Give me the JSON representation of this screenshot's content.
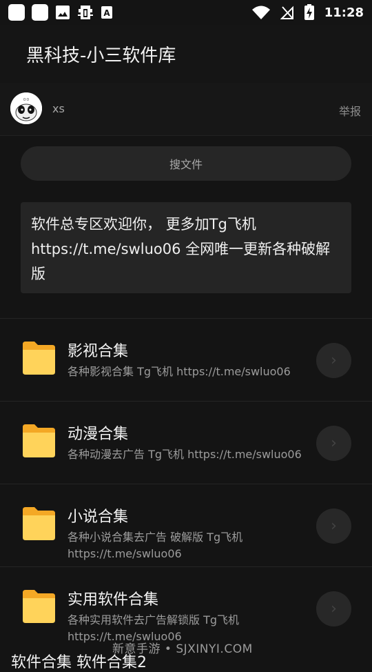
{
  "status": {
    "time": "11:28",
    "icons": [
      "app-icon-1",
      "app-icon-2",
      "image-icon",
      "bug-icon",
      "font-icon",
      "wifi-icon",
      "no-signal-icon",
      "battery-charging-icon"
    ]
  },
  "app": {
    "title": "黑科技-小三软件库"
  },
  "user": {
    "name": "xs",
    "report_label": "举报"
  },
  "search": {
    "label": "搜文件"
  },
  "notice": {
    "text": "软件总专区欢迎你， 更多加Tg飞机 https://t.me/swluo06 全网唯一更新各种破解版"
  },
  "items": [
    {
      "title": "影视合集",
      "desc": "各种影视合集 Tg飞机 https://t.me/swluo06"
    },
    {
      "title": "动漫合集",
      "desc": "各种动漫去广告 Tg飞机 https://t.me/swluo06"
    },
    {
      "title": "小说合集",
      "desc": "各种小说合集去广告 破解版 Tg飞机 https://t.me/swluo06"
    },
    {
      "title": "实用软件合集",
      "desc": "各种实用软件去广告解锁版 Tg飞机 https://t.me/swluo06"
    }
  ],
  "footer": {
    "watermark": "新意手游 • SJXINYI.COM",
    "bottom_text": "软件合集    软件合集2"
  }
}
